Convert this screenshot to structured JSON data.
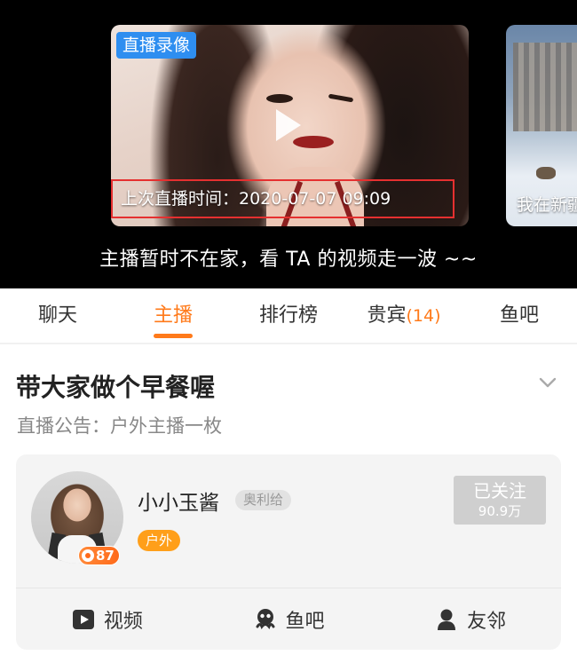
{
  "video": {
    "badge": "直播录像",
    "last_live": "上次直播时间：2020-07-07 09:09",
    "side_caption": "我在新疆",
    "away_message": "主播暂时不在家，看 TA 的视频走一波 ~~"
  },
  "tabs": [
    {
      "label": "聊天",
      "active": false
    },
    {
      "label": "主播",
      "active": true
    },
    {
      "label": "排行榜",
      "active": false
    },
    {
      "label": "贵宾",
      "count": "(14)",
      "active": false
    },
    {
      "label": "鱼吧",
      "active": false
    }
  ],
  "room": {
    "title": "带大家做个早餐喔",
    "notice": "直播公告：户外主播一枚"
  },
  "anchor": {
    "name": "小小玉酱",
    "team_tag": "奥利给",
    "category": "户外",
    "level": "87",
    "follow_label": "已关注",
    "followers": "90.9万"
  },
  "actions": [
    {
      "label": "视频",
      "icon": "video-icon"
    },
    {
      "label": "鱼吧",
      "icon": "fish-bar-icon"
    },
    {
      "label": "友邻",
      "icon": "friend-icon"
    }
  ],
  "colors": {
    "accent": "#ff7a1a",
    "live_badge": "#2e8ef0",
    "highlight_border": "#e53030",
    "category_tag": "#ff9f1a"
  }
}
